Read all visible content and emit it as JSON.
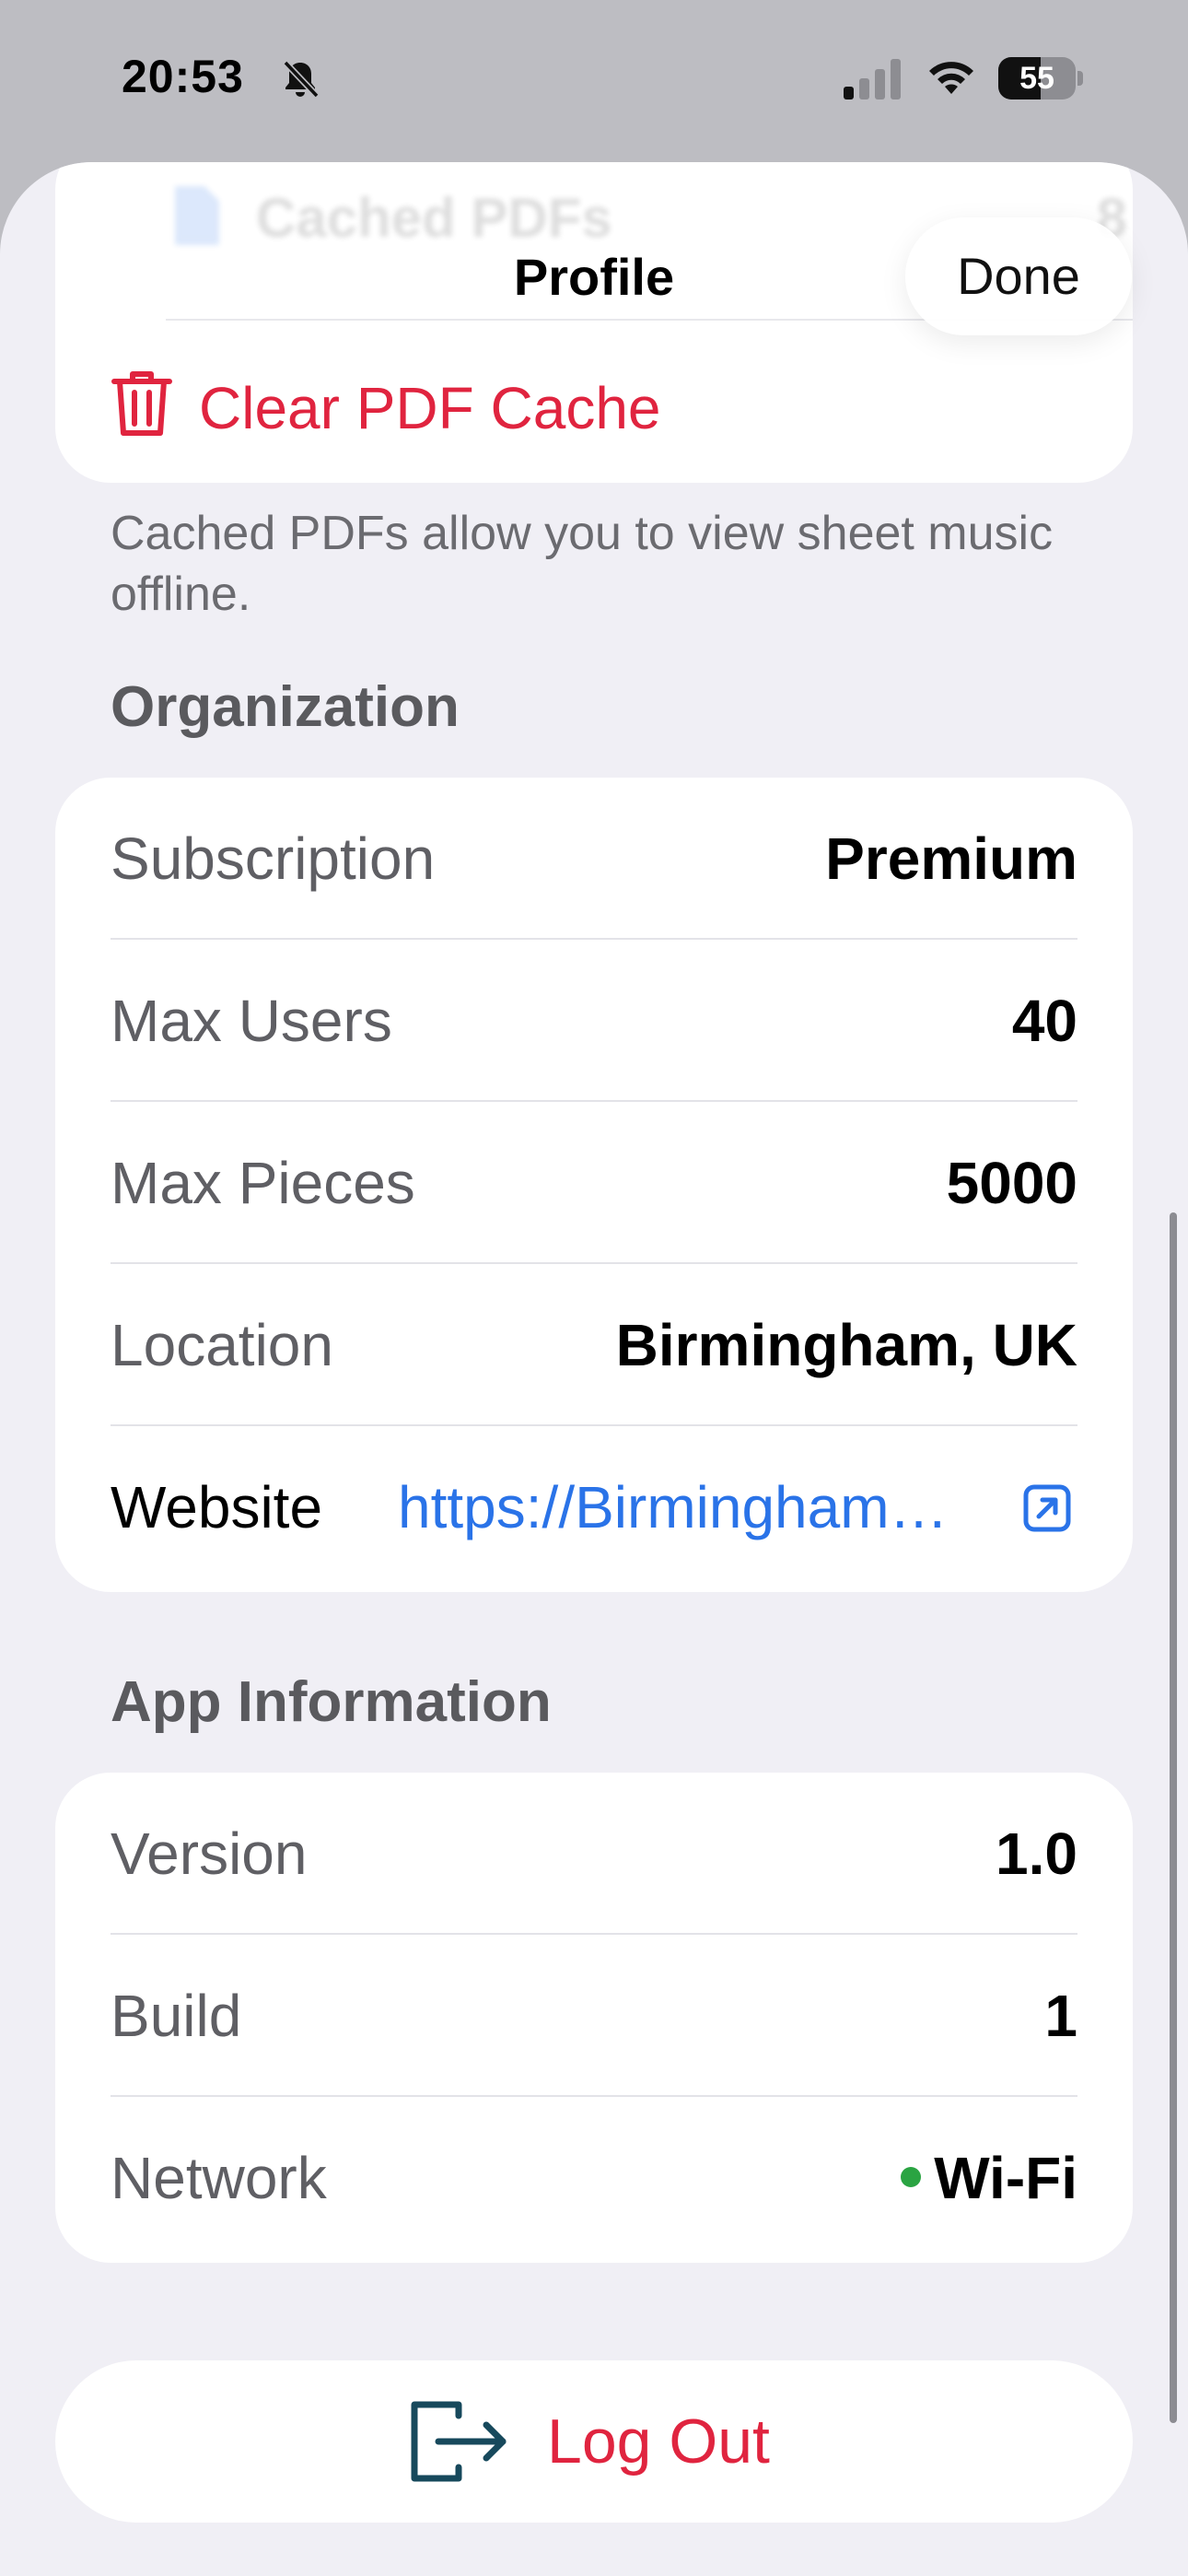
{
  "status_bar": {
    "time": "20:53",
    "battery_level": 55,
    "battery_text": "55",
    "icons": [
      "bell-slash-icon",
      "cellular-signal-icon",
      "wifi-icon",
      "battery-icon"
    ]
  },
  "sheet": {
    "title": "Profile",
    "done_label": "Done",
    "cached_pdfs": {
      "label": "Cached PDFs",
      "value": "8"
    },
    "clear_cache_label": "Clear PDF Cache",
    "cache_footer": "Cached PDFs allow you to view sheet music offline."
  },
  "organization": {
    "header": "Organization",
    "rows": [
      {
        "label": "Subscription",
        "value": "Premium"
      },
      {
        "label": "Max Users",
        "value": "40"
      },
      {
        "label": "Max Pieces",
        "value": "5000"
      },
      {
        "label": "Location",
        "value": "Birmingham, UK"
      }
    ],
    "website": {
      "label": "Website",
      "value": "https://Birmingham…"
    }
  },
  "app_info": {
    "header": "App Information",
    "rows": [
      {
        "label": "Version",
        "value": "1.0"
      },
      {
        "label": "Build",
        "value": "1"
      }
    ],
    "network": {
      "label": "Network",
      "value": "Wi-Fi"
    }
  },
  "logout_label": "Log Out",
  "colors": {
    "destructive": "#e0243f",
    "link": "#2a73e8",
    "network_ok": "#2aa442",
    "logout_icon": "#17495c"
  }
}
